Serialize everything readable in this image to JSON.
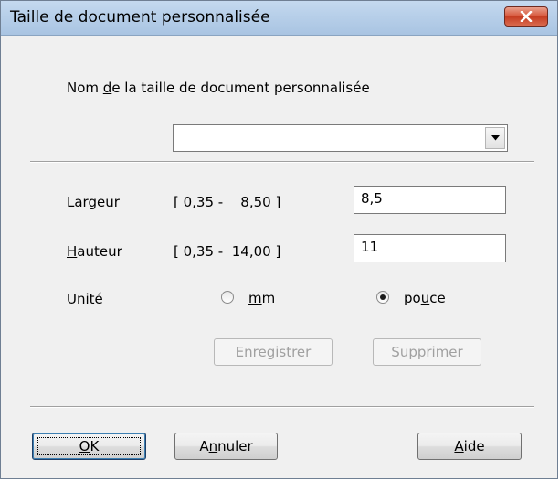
{
  "window": {
    "title": "Taille de document personnalisée"
  },
  "name_section": {
    "label_before": "Nom ",
    "label_mnemonic": "d",
    "label_after": "e la taille de document personnalisée",
    "value": ""
  },
  "width": {
    "label_mnemonic": "L",
    "label_rest": "argeur",
    "range": "[ 0,35 -    8,50 ]",
    "value": "8,5"
  },
  "height": {
    "label_mnemonic": "H",
    "label_rest": "auteur",
    "range": "[ 0,35 -  14,00 ]",
    "value": "11"
  },
  "unit": {
    "label": "Unité",
    "options": [
      {
        "before": "",
        "mnemonic": "m",
        "after": "m",
        "selected": false
      },
      {
        "before": "po",
        "mnemonic": "u",
        "after": "ce",
        "selected": true
      }
    ]
  },
  "actions": {
    "save": {
      "mnemonic": "E",
      "rest": "nregistrer",
      "enabled": false
    },
    "delete": {
      "mnemonic": "S",
      "rest": "upprimer",
      "enabled": false
    }
  },
  "footer": {
    "ok": {
      "mnemonic": "O",
      "rest": "K"
    },
    "cancel": {
      "before": "A",
      "mnemonic": "n",
      "rest": "nuler"
    },
    "help": {
      "mnemonic": "A",
      "rest": "ide"
    }
  }
}
